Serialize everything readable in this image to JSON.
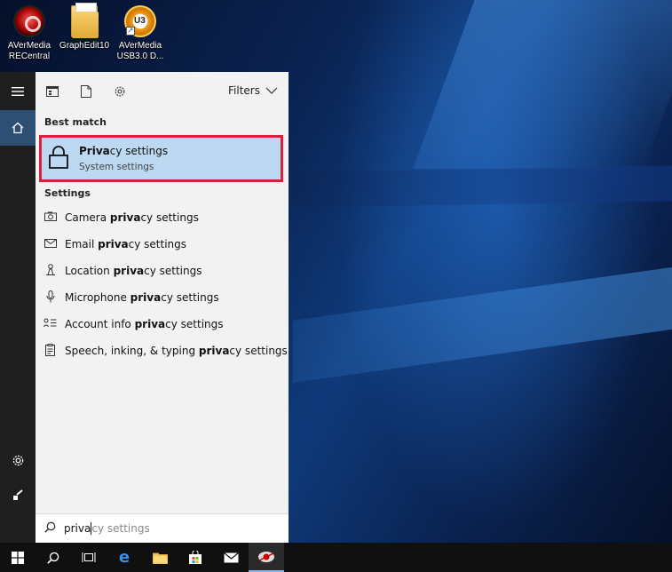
{
  "desktop": {
    "icons": [
      {
        "label": "AVerMedia RECentral",
        "icon": "avermedia-recentral-icon"
      },
      {
        "label": "GraphEdit10",
        "icon": "folder-icon"
      },
      {
        "label": "AVerMedia USB3.0 D...",
        "icon": "avermedia-usb3-icon",
        "badge": "U3"
      }
    ]
  },
  "rail": {
    "items": [
      {
        "icon": "hamburger-menu-icon",
        "glyph": "☰"
      },
      {
        "icon": "home-icon",
        "glyph": "⌂"
      },
      {
        "icon": "settings-gear-icon",
        "glyph": "⚙"
      },
      {
        "icon": "feedback-icon",
        "glyph": "✎"
      }
    ]
  },
  "toolbar": {
    "filters_label": "Filters",
    "icons": [
      "apps-icon",
      "documents-icon",
      "settings-icon"
    ]
  },
  "results": {
    "best_match_title": "Best match",
    "best_match": {
      "title_bold": "Priva",
      "title_rest": "cy settings",
      "subtitle": "System settings",
      "icon": "lock-icon"
    },
    "settings_title": "Settings",
    "settings": [
      {
        "pre": "Camera ",
        "bold": "priva",
        "post": "cy settings",
        "icon": "camera-icon",
        "glyph": "📷"
      },
      {
        "pre": "Email ",
        "bold": "priva",
        "post": "cy settings",
        "icon": "mail-icon",
        "glyph": "✉"
      },
      {
        "pre": "Location ",
        "bold": "priva",
        "post": "cy settings",
        "icon": "location-icon",
        "glyph": "♙"
      },
      {
        "pre": "Microphone ",
        "bold": "priva",
        "post": "cy settings",
        "icon": "microphone-icon",
        "glyph": "🎤"
      },
      {
        "pre": "Account info ",
        "bold": "priva",
        "post": "cy settings",
        "icon": "account-info-icon",
        "glyph": "☰"
      },
      {
        "pre": "Speech, inking, & typing ",
        "bold": "priva",
        "post": "cy settings",
        "icon": "speech-icon",
        "glyph": "▤"
      }
    ]
  },
  "search": {
    "typed": "priva",
    "suggestion": "cy settings"
  },
  "taskbar": {
    "items": [
      {
        "icon": "windows-start-icon",
        "glyph": "⊞"
      },
      {
        "icon": "search-icon",
        "glyph": "⚲"
      },
      {
        "icon": "task-view-icon",
        "glyph": "⧉"
      },
      {
        "icon": "edge-browser-icon",
        "glyph": "e"
      },
      {
        "icon": "file-explorer-icon",
        "glyph": "▭"
      },
      {
        "icon": "store-icon",
        "glyph": "🛍"
      },
      {
        "icon": "mail-icon",
        "glyph": "✉"
      },
      {
        "icon": "avermedia-app-icon",
        "glyph": "◉"
      }
    ]
  },
  "colors": {
    "accent_selected": "#bcd9f1",
    "highlight_border": "#d8213b",
    "rail_active": "#2d4f73"
  }
}
